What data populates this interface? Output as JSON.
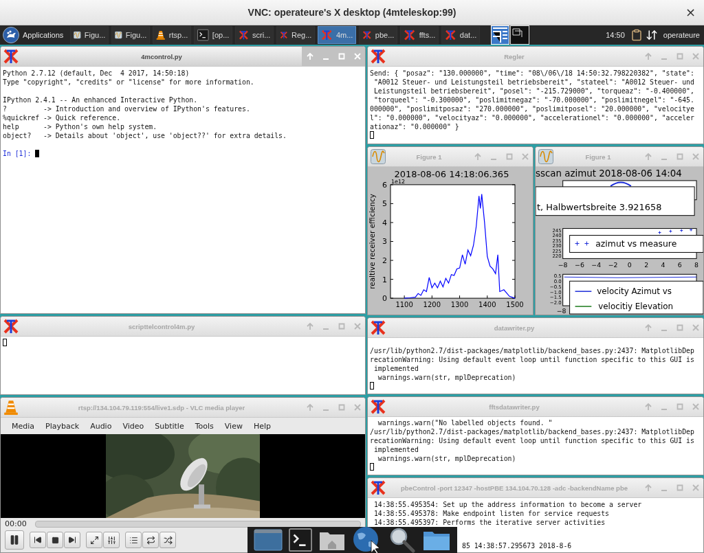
{
  "vnc": {
    "title": "VNC: operateure's X desktop (4mteleskop:99)",
    "close": "×"
  },
  "taskbar": {
    "menu": "Applications",
    "tasks": [
      {
        "kind": "figure",
        "label": "Figu...",
        "selected": false
      },
      {
        "kind": "figure",
        "label": "Figu...",
        "selected": false
      },
      {
        "kind": "vlc",
        "label": "rtsp...",
        "selected": false
      },
      {
        "kind": "terminal",
        "label": "[op...",
        "selected": false
      },
      {
        "kind": "x",
        "label": "scri...",
        "selected": false
      },
      {
        "kind": "x",
        "label": "Reg...",
        "selected": false
      },
      {
        "kind": "x",
        "label": "4m...",
        "selected": true
      },
      {
        "kind": "x",
        "label": "pbe...",
        "selected": false
      },
      {
        "kind": "x",
        "label": "ffts...",
        "selected": false
      },
      {
        "kind": "x",
        "label": "dat...",
        "selected": false
      }
    ],
    "clock": "14:50",
    "user": "operateure"
  },
  "windows": {
    "console": {
      "kind": "x",
      "title": "4mcontrol.py",
      "active": true,
      "paragraphs": [
        [
          "Python 2.7.12 (default, Dec  4 2017, 14:50:18)",
          "Type \"copyright\", \"credits\" or \"license\" for more information."
        ],
        [
          "IPython 2.4.1 -- An enhanced Interactive Python.",
          "?         -> Introduction and overview of IPython's features.",
          "%quickref -> Quick reference.",
          "help      -> Python's own help system.",
          "object?   -> Details about 'object', use 'object??' for extra details."
        ]
      ],
      "prompt": "In [1]:",
      "cursor_focused": true
    },
    "regler": {
      "kind": "x",
      "title": "Regler",
      "active": false,
      "lines": [
        "Send: { \"posaz\": \"130.000000\", \"time\": \"08\\/06\\/18 14:50:32.798220382\", \"state\":",
        " \"A0012 Steuer- und Leistungsteil betriebsbereit\", \"stateel\": \"A0012 Steuer- und",
        " Leistungsteil betriebsbereit\", \"posel\": \"-215.729000\", \"torqueaz\": \"-0.400000\",",
        " \"torqueel\": \"-0.300000\", \"poslimitnegaz\": \"-70.000000\", \"poslimitnegel\": \"-645.",
        "000000\", \"poslimitposaz\": \"270.000000\", \"poslimitposel\": \"20.000000\", \"velocitye",
        "l\": \"0.000000\", \"velocityaz\": \"0.000000\", \"accelerationel\": \"0.000000\", \"acceler",
        "ationaz\": \"0.000000\" }"
      ],
      "cursor_focused": false
    },
    "figure_1": {
      "kind": "figure",
      "title": "Figure 1",
      "active": false,
      "offset_label": "1e12",
      "chart_data": {
        "type": "line",
        "title": "2018-08-06 14:18:06.365",
        "ylabel": "realtive receiver efficiency",
        "x": [
          1100,
          1120,
          1140,
          1150,
          1160,
          1170,
          1180,
          1190,
          1200,
          1210,
          1220,
          1230,
          1240,
          1250,
          1260,
          1270,
          1280,
          1290,
          1300,
          1310,
          1320,
          1330,
          1340,
          1350,
          1360,
          1370,
          1375,
          1380,
          1390,
          1400,
          1410,
          1420,
          1430,
          1438,
          1445,
          1460,
          1480,
          1500
        ],
        "series": [
          {
            "color": "#0000ff",
            "values": [
              0,
              0.02,
              0.05,
              0.25,
              0.15,
              0.45,
              0.35,
              1.1,
              0.55,
              0.8,
              0.55,
              0.9,
              0.6,
              1.05,
              0.8,
              1.25,
              1.2,
              1.55,
              1.6,
              2.3,
              1.8,
              2.55,
              2.25,
              2.8,
              3.8,
              5.4,
              4.75,
              5.5,
              4.0,
              2.2,
              1.7,
              1.55,
              1.3,
              2.3,
              0.35,
              0.45,
              0.1,
              0
            ]
          }
        ],
        "xlim": [
          1050,
          1500
        ],
        "ylim": [
          0,
          6
        ],
        "xticks": [
          1100,
          1200,
          1300,
          1400,
          1500
        ],
        "yticks": [
          0,
          1,
          2,
          3,
          4,
          5,
          6
        ]
      }
    },
    "figure_2": {
      "kind": "figure",
      "title": "Figure 1",
      "active": false,
      "plot_title": "sscan azimut 2018-08-06 14:04",
      "legend_1": "t, Halbwertsbreite 3.921658",
      "panel_2": {
        "yticks": [
          "245",
          "240",
          "235",
          "230",
          "225",
          "220"
        ],
        "xticks": [
          "−8",
          "−6",
          "−4",
          "−2",
          "0",
          "2",
          "4",
          "6",
          "8"
        ],
        "legend": "azimut vs measure"
      },
      "panel_3": {
        "yticks": [
          "0.5",
          "0.0",
          "−0.5",
          "−1.0",
          "−1.5",
          "−2.0"
        ],
        "xticks": [
          "−8"
        ],
        "legend": [
          "velocity Azimut vs",
          "velocitiy Elevation"
        ]
      }
    },
    "script": {
      "kind": "x",
      "title": "scripttelcontrol4m.py",
      "active": false,
      "cursor_focused": false
    },
    "vlc": {
      "kind": "vlc",
      "title": "rtsp://134.104.79.119:554/live1.sdp - VLC media player",
      "active": false,
      "menu": [
        "Media",
        "Playback",
        "Audio",
        "Video",
        "Subtitle",
        "Tools",
        "View",
        "Help"
      ],
      "time": "00:00",
      "level": 0
    },
    "datawriter": {
      "kind": "x",
      "title": "datawriter.py",
      "active": false,
      "lines": [
        "/usr/lib/python2.7/dist-packages/matplotlib/backend_bases.py:2437: MatplotlibDep",
        "recationWarning: Using default event loop until function specific to this GUI is",
        " implemented",
        "  warnings.warn(str, mplDeprecation)"
      ],
      "cursor_focused": false
    },
    "ffts": {
      "kind": "x",
      "title": "fftsdatawriter.py",
      "active": false,
      "lines": [
        "  warnings.warn(\"No labelled objects found. \"",
        "/usr/lib/python2.7/dist-packages/matplotlib/backend_bases.py:2437: MatplotlibDep",
        "recationWarning: Using default event loop until function specific to this GUI is",
        " implemented",
        "  warnings.warn(str, mplDeprecation)"
      ],
      "cursor_focused": false
    },
    "pbe": {
      "kind": "x",
      "title": "pbeControl -port 12347 -hostPBE 134.104.70.128 -adc -backendName pbe",
      "active": false,
      "lines": [
        " 14:38:55.495354: Set up the address information to become a server",
        " 14:38:55.495378: Make endpoint listen for service requests",
        " 14:38:55.495397: Performs the iterative server activities"
      ],
      "last_line": "85 14:38:57.295673 2018-8-6"
    }
  }
}
